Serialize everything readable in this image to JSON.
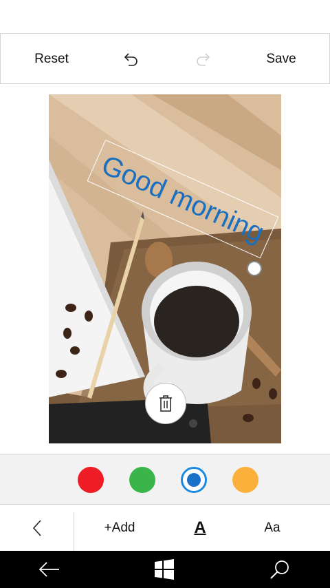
{
  "toolbar": {
    "reset_label": "Reset",
    "save_label": "Save",
    "undo_icon": "undo-icon",
    "redo_icon": "redo-icon",
    "redo_enabled": false
  },
  "canvas": {
    "overlay_text": "Good morning",
    "overlay_text_color": "#1a6fbf"
  },
  "colors": {
    "swatches": [
      {
        "name": "red",
        "value": "#ee1c25",
        "selected": false
      },
      {
        "name": "green",
        "value": "#39b54a",
        "selected": false
      },
      {
        "name": "blue",
        "value": "#1a72c8",
        "selected": true
      },
      {
        "name": "orange",
        "value": "#fbb03b",
        "selected": false
      }
    ]
  },
  "options": {
    "add_label": "+Add",
    "font_color_label": "A",
    "font_size_label": "Aa"
  },
  "navbar": {
    "icons": [
      "back-arrow-icon",
      "windows-logo-icon",
      "search-icon"
    ]
  }
}
